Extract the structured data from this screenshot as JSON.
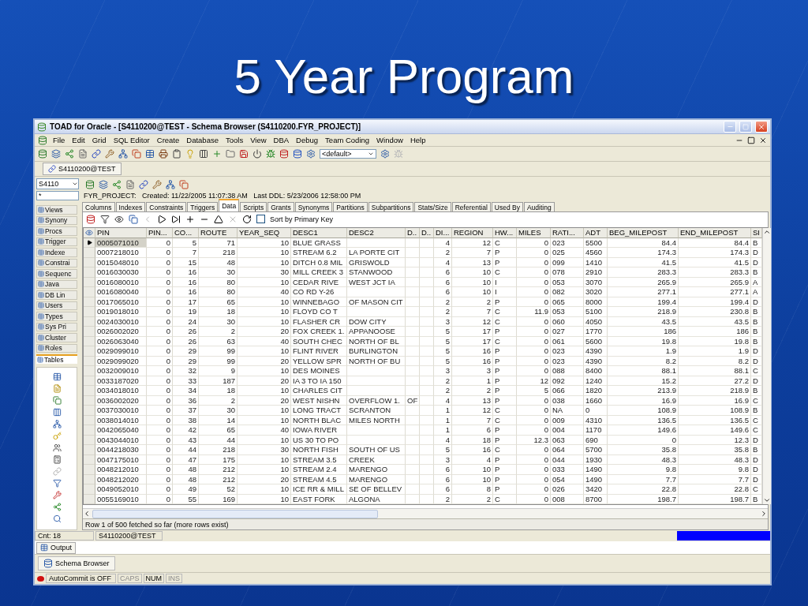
{
  "slide": {
    "title": "5 Year Program"
  },
  "window": {
    "title": "TOAD for Oracle - [S4110200@TEST - Schema Browser (S4110200.FYR_PROJECT)]"
  },
  "menu": [
    "File",
    "Edit",
    "Grid",
    "SQL Editor",
    "Create",
    "Database",
    "Tools",
    "View",
    "DBA",
    "Debug",
    "Team Coding",
    "Window",
    "Help"
  ],
  "toolbar": {
    "dropdown": "<default>"
  },
  "connection_tab": "S4110200@TEST",
  "schema_browser": {
    "schema": "S4110",
    "filter": "*",
    "object_types": [
      {
        "label": "Views",
        "selected": false
      },
      {
        "label": "Synony",
        "selected": false
      },
      {
        "label": "Procs",
        "selected": false
      },
      {
        "label": "Trigger",
        "selected": false
      },
      {
        "label": "Indexe",
        "selected": false
      },
      {
        "label": "Constrai",
        "selected": false
      },
      {
        "label": "Sequenc",
        "selected": false
      },
      {
        "label": "Java",
        "selected": false
      },
      {
        "label": "DB Lin",
        "selected": false
      },
      {
        "label": "Users",
        "selected": false
      },
      {
        "label": "Types",
        "selected": false
      },
      {
        "label": "Sys Pri",
        "selected": false
      },
      {
        "label": "Cluster",
        "selected": false
      },
      {
        "label": "Roles",
        "selected": false
      },
      {
        "label": "Tables",
        "selected": true
      }
    ],
    "object_info": "FYR_PROJECT:   Created: 11/22/2005 11:07:38 AM   Last DDL: 5/23/2006 12:58:00 PM",
    "tabs": [
      {
        "label": "Columns",
        "selected": false
      },
      {
        "label": "Indexes",
        "selected": false
      },
      {
        "label": "Constraints",
        "selected": false
      },
      {
        "label": "Triggers",
        "selected": false
      },
      {
        "label": "Data",
        "selected": true
      },
      {
        "label": "Scripts",
        "selected": false
      },
      {
        "label": "Grants",
        "selected": false
      },
      {
        "label": "Synonyms",
        "selected": false
      },
      {
        "label": "Partitions",
        "selected": false
      },
      {
        "label": "Subpartitions",
        "selected": false
      },
      {
        "label": "Stats/Size",
        "selected": false
      },
      {
        "label": "Referential",
        "selected": false
      },
      {
        "label": "Used By",
        "selected": false
      },
      {
        "label": "Auditing",
        "selected": false
      }
    ],
    "sort_by_primary_key": {
      "label": "Sort by Primary Key",
      "checked": false
    },
    "grid": {
      "columns": [
        {
          "label": "PIN",
          "kind": "text"
        },
        {
          "label": "PIN...",
          "kind": "number"
        },
        {
          "label": "CO...",
          "kind": "number"
        },
        {
          "label": "ROUTE",
          "kind": "number"
        },
        {
          "label": "YEAR_SEQ",
          "kind": "number"
        },
        {
          "label": "DESC1",
          "kind": "text"
        },
        {
          "label": "DESC2",
          "kind": "text"
        },
        {
          "label": "D..",
          "kind": "text"
        },
        {
          "label": "D..",
          "kind": "text"
        },
        {
          "label": "DI...",
          "kind": "number"
        },
        {
          "label": "REGION",
          "kind": "number"
        },
        {
          "label": "HW...",
          "kind": "text"
        },
        {
          "label": "MILES",
          "kind": "number"
        },
        {
          "label": "RATI...",
          "kind": "text"
        },
        {
          "label": "ADT",
          "kind": "text"
        },
        {
          "label": "BEG_MILEPOST",
          "kind": "number"
        },
        {
          "label": "END_MILEPOST",
          "kind": "number"
        },
        {
          "label": "SI",
          "kind": "text"
        }
      ],
      "rows": [
        {
          "selected": true,
          "cells": [
            "0005071010",
            "0",
            "5",
            "71",
            "10",
            "BLUE GRASS",
            null,
            null,
            null,
            "4",
            "12",
            "C",
            "0",
            "023",
            "5500",
            "84.4",
            "84.4",
            "B"
          ]
        },
        {
          "selected": false,
          "cells": [
            "0007218010",
            "0",
            "7",
            "218",
            "10",
            "STREAM 6.2",
            "LA PORTE CIT",
            null,
            null,
            "2",
            "7",
            "P",
            "0",
            "025",
            "4560",
            "174.3",
            "174.3",
            "D"
          ]
        },
        {
          "selected": false,
          "cells": [
            "0015048010",
            "0",
            "15",
            "48",
            "10",
            "DITCH 0.8 MIL",
            "GRISWOLD",
            null,
            null,
            "4",
            "13",
            "P",
            "0",
            "099",
            "1410",
            "41.5",
            "41.5",
            "D"
          ]
        },
        {
          "selected": false,
          "cells": [
            "0016030030",
            "0",
            "16",
            "30",
            "30",
            "MILL CREEK 3",
            "STANWOOD",
            null,
            null,
            "6",
            "10",
            "C",
            "0",
            "078",
            "2910",
            "283.3",
            "283.3",
            "B"
          ]
        },
        {
          "selected": false,
          "cells": [
            "0016080010",
            "0",
            "16",
            "80",
            "10",
            "CEDAR RIVE",
            "WEST JCT IA",
            null,
            null,
            "6",
            "10",
            "I",
            "0",
            "053",
            "3070",
            "265.9",
            "265.9",
            "A"
          ]
        },
        {
          "selected": false,
          "cells": [
            "0016080040",
            "0",
            "16",
            "80",
            "40",
            "CO RD Y-26",
            null,
            null,
            null,
            "6",
            "10",
            "I",
            "0",
            "082",
            "3020",
            "277.1",
            "277.1",
            "A"
          ]
        },
        {
          "selected": false,
          "cells": [
            "0017065010",
            "0",
            "17",
            "65",
            "10",
            "WINNEBAGO",
            "OF MASON CIT",
            null,
            null,
            "2",
            "2",
            "P",
            "0",
            "065",
            "8000",
            "199.4",
            "199.4",
            "D"
          ]
        },
        {
          "selected": false,
          "cells": [
            "0019018010",
            "0",
            "19",
            "18",
            "10",
            "FLOYD CO T",
            null,
            null,
            null,
            "2",
            "7",
            "C",
            "11.9",
            "053",
            "5100",
            "218.9",
            "230.8",
            "B"
          ]
        },
        {
          "selected": false,
          "cells": [
            "0024030010",
            "0",
            "24",
            "30",
            "10",
            "FLASHER CR",
            "DOW CITY",
            null,
            null,
            "3",
            "12",
            "C",
            "0",
            "060",
            "4050",
            "43.5",
            "43.5",
            "B"
          ]
        },
        {
          "selected": false,
          "cells": [
            "0026002020",
            "0",
            "26",
            "2",
            "20",
            "FOX CREEK 1.",
            "APPANOOSE",
            null,
            null,
            "5",
            "17",
            "P",
            "0",
            "027",
            "1770",
            "186",
            "186",
            "B"
          ]
        },
        {
          "selected": false,
          "cells": [
            "0026063040",
            "0",
            "26",
            "63",
            "40",
            "SOUTH CHEC",
            "NORTH OF BL",
            null,
            null,
            "5",
            "17",
            "C",
            "0",
            "061",
            "5600",
            "19.8",
            "19.8",
            "B"
          ]
        },
        {
          "selected": false,
          "cells": [
            "0029099010",
            "0",
            "29",
            "99",
            "10",
            "FLINT RIVER",
            "BURLINGTON",
            null,
            null,
            "5",
            "16",
            "P",
            "0",
            "023",
            "4390",
            "1.9",
            "1.9",
            "D"
          ]
        },
        {
          "selected": false,
          "cells": [
            "0029099020",
            "0",
            "29",
            "99",
            "20",
            "YELLOW SPR",
            "NORTH OF BU",
            null,
            null,
            "5",
            "16",
            "P",
            "0",
            "023",
            "4390",
            "8.2",
            "8.2",
            "D"
          ]
        },
        {
          "selected": false,
          "cells": [
            "0032009010",
            "0",
            "32",
            "9",
            "10",
            "DES MOINES",
            null,
            null,
            null,
            "3",
            "3",
            "P",
            "0",
            "088",
            "8400",
            "88.1",
            "88.1",
            "C"
          ]
        },
        {
          "selected": false,
          "cells": [
            "0033187020",
            "0",
            "33",
            "187",
            "20",
            "IA 3 TO IA 150",
            null,
            null,
            null,
            "2",
            "1",
            "P",
            "12",
            "092",
            "1240",
            "15.2",
            "27.2",
            "D"
          ]
        },
        {
          "selected": false,
          "cells": [
            "0034018010",
            "0",
            "34",
            "18",
            "10",
            "CHARLES CIT",
            null,
            null,
            null,
            "2",
            "2",
            "P",
            "5",
            "066",
            "1820",
            "213.9",
            "218.9",
            "B"
          ]
        },
        {
          "selected": false,
          "cells": [
            "0036002020",
            "0",
            "36",
            "2",
            "20",
            "WEST NISHN",
            "OVERFLOW 1.",
            "OF",
            null,
            "4",
            "13",
            "P",
            "0",
            "038",
            "1660",
            "16.9",
            "16.9",
            "C"
          ]
        },
        {
          "selected": false,
          "cells": [
            "0037030010",
            "0",
            "37",
            "30",
            "10",
            "LONG TRACT",
            "SCRANTON",
            null,
            null,
            "1",
            "12",
            "C",
            "0",
            "NA",
            "0",
            "108.9",
            "108.9",
            "B"
          ]
        },
        {
          "selected": false,
          "cells": [
            "0038014010",
            "0",
            "38",
            "14",
            "10",
            "NORTH BLAC",
            "MILES NORTH",
            null,
            null,
            "1",
            "7",
            "C",
            "0",
            "009",
            "4310",
            "136.5",
            "136.5",
            "C"
          ]
        },
        {
          "selected": false,
          "cells": [
            "0042065040",
            "0",
            "42",
            "65",
            "40",
            "IOWA RIVER",
            null,
            null,
            null,
            "1",
            "6",
            "P",
            "0",
            "004",
            "1170",
            "149.6",
            "149.6",
            "C"
          ]
        },
        {
          "selected": false,
          "cells": [
            "0043044010",
            "0",
            "43",
            "44",
            "10",
            "US 30 TO PO",
            null,
            null,
            null,
            "4",
            "18",
            "P",
            "12.3",
            "063",
            "690",
            "0",
            "12.3",
            "D"
          ]
        },
        {
          "selected": false,
          "cells": [
            "0044218030",
            "0",
            "44",
            "218",
            "30",
            "NORTH FISH",
            "SOUTH OF US",
            null,
            null,
            "5",
            "16",
            "C",
            "0",
            "064",
            "5700",
            "35.8",
            "35.8",
            "B"
          ]
        },
        {
          "selected": false,
          "cells": [
            "0047175010",
            "0",
            "47",
            "175",
            "10",
            "STREAM 3.5",
            "CREEK",
            null,
            null,
            "3",
            "4",
            "P",
            "0",
            "044",
            "1930",
            "48.3",
            "48.3",
            "D"
          ]
        },
        {
          "selected": false,
          "cells": [
            "0048212010",
            "0",
            "48",
            "212",
            "10",
            "STREAM 2.4",
            "MARENGO",
            null,
            null,
            "6",
            "10",
            "P",
            "0",
            "033",
            "1490",
            "9.8",
            "9.8",
            "D"
          ]
        },
        {
          "selected": false,
          "cells": [
            "0048212020",
            "0",
            "48",
            "212",
            "20",
            "STREAM 4.5",
            "MARENGO",
            null,
            null,
            "6",
            "10",
            "P",
            "0",
            "054",
            "1490",
            "7.7",
            "7.7",
            "D"
          ]
        },
        {
          "selected": false,
          "cells": [
            "0049052010",
            "0",
            "49",
            "52",
            "10",
            "ICE RR & MILL",
            "SE OF BELLEV",
            null,
            null,
            "6",
            "8",
            "P",
            "0",
            "026",
            "3420",
            "22.8",
            "22.8",
            "C"
          ]
        },
        {
          "selected": false,
          "cells": [
            "0055169010",
            "0",
            "55",
            "169",
            "10",
            "EAST FORK",
            "ALGONA",
            null,
            null,
            "2",
            "2",
            "C",
            "0",
            "008",
            "8700",
            "198.7",
            "198.7",
            "B"
          ]
        }
      ]
    },
    "grid_status": "Row 1 of 500 fetched so far (more rows exist)"
  },
  "panel_status": {
    "count": "Cnt: 18",
    "connection": "S4110200@TEST"
  },
  "output_tab": "Output",
  "window_tab": "Schema Browser",
  "status_bar": {
    "autocommit": "AutoCommit is OFF",
    "keys": [
      {
        "label": "CAPS",
        "on": false
      },
      {
        "label": "NUM",
        "on": true
      },
      {
        "label": "INS",
        "on": false
      }
    ]
  }
}
